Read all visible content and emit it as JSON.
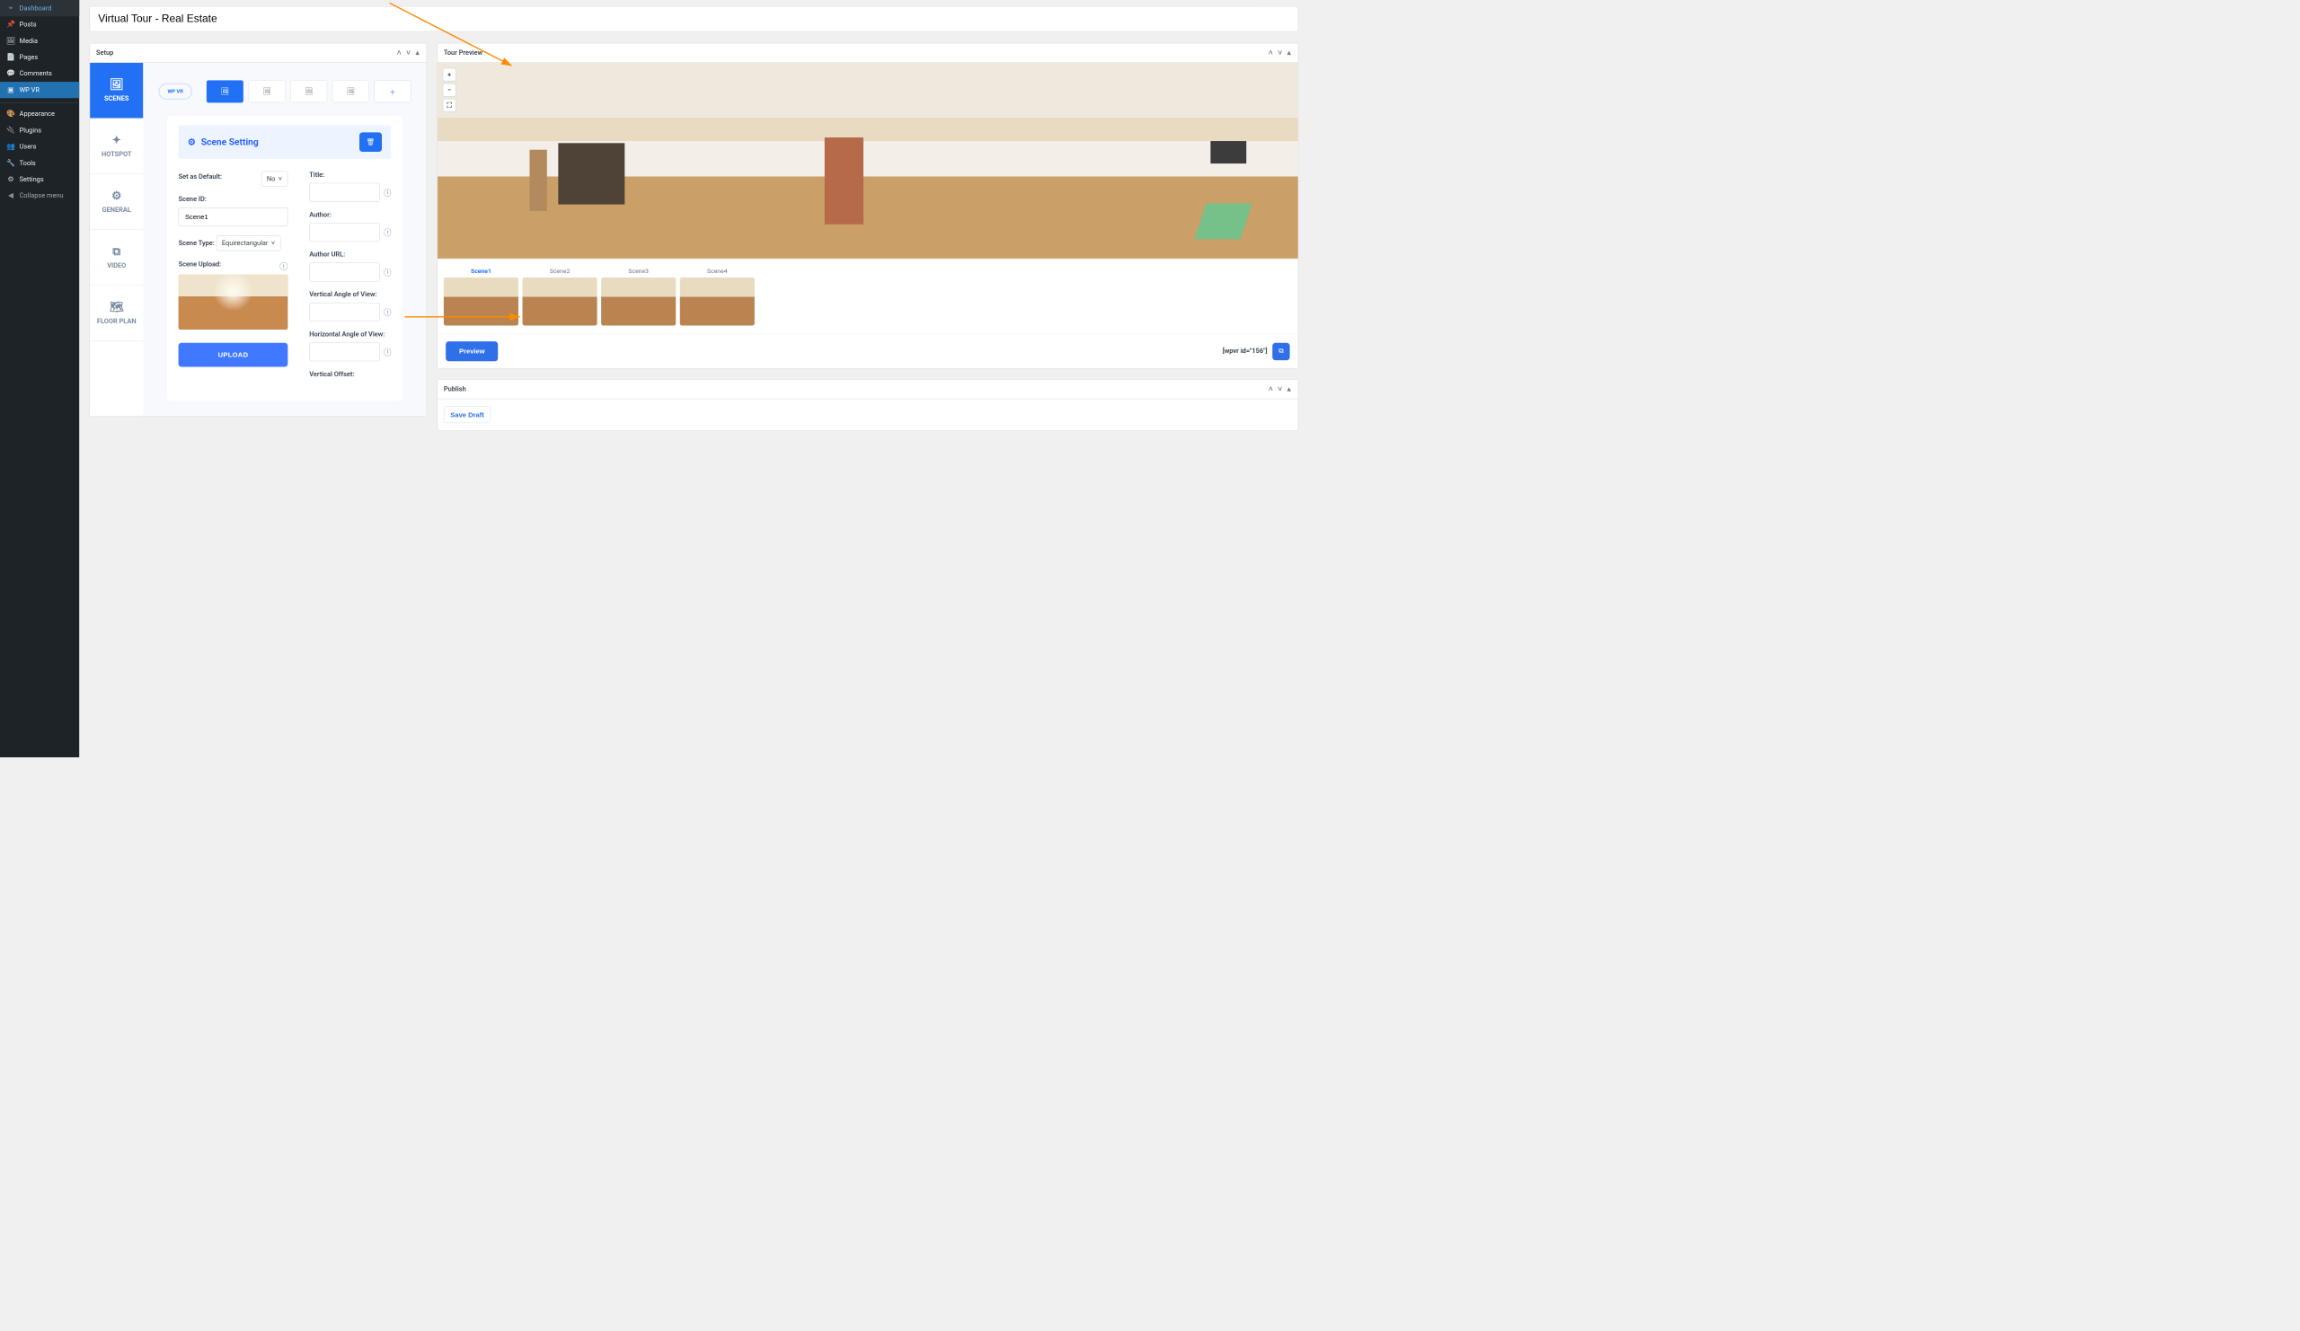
{
  "sidebar": {
    "items": [
      {
        "icon": "⌖",
        "label": "Dashboard"
      },
      {
        "icon": "📌",
        "label": "Posts"
      },
      {
        "icon": "🖼",
        "label": "Media"
      },
      {
        "icon": "📄",
        "label": "Pages"
      },
      {
        "icon": "💬",
        "label": "Comments"
      },
      {
        "icon": "▣",
        "label": "WP VR",
        "active": true
      }
    ],
    "items2": [
      {
        "icon": "🎨",
        "label": "Appearance"
      },
      {
        "icon": "🔌",
        "label": "Plugins"
      },
      {
        "icon": "👥",
        "label": "Users"
      },
      {
        "icon": "🔧",
        "label": "Tools"
      },
      {
        "icon": "⚙",
        "label": "Settings"
      }
    ],
    "collapse": "Collapse menu"
  },
  "title": "Virtual Tour - Real Estate",
  "setup": {
    "title": "Setup",
    "logo": "WP VR",
    "vtabs": [
      {
        "icon": "🖼",
        "label": "SCENES",
        "active": true
      },
      {
        "icon": "✦",
        "label": "HOTSPOT"
      },
      {
        "icon": "⚙",
        "label": "GENERAL"
      },
      {
        "icon": "⧉",
        "label": "VIDEO"
      },
      {
        "icon": "🗺",
        "label": "FLOOR PLAN"
      }
    ],
    "scene_panel": {
      "title": "Scene Setting",
      "set_default_label": "Set as Default:",
      "set_default_value": "No",
      "scene_id_label": "Scene ID:",
      "scene_id_value": "Scene1",
      "scene_type_label": "Scene Type:",
      "scene_type_value": "Equirectangular",
      "scene_upload_label": "Scene Upload:",
      "upload_btn": "UPLOAD",
      "title_label": "Title:",
      "author_label": "Author:",
      "author_url_label": "Author URL:",
      "vangle_label": "Vertical Angle of View:",
      "hangle_label": "Horizontal Angle of View:",
      "voffset_label": "Vertical Offset:"
    }
  },
  "preview": {
    "title": "Tour Preview",
    "zoom_in": "+",
    "zoom_out": "−",
    "fullscreen": "⛶",
    "scenes": [
      "Scene1",
      "Scene2",
      "Scene3",
      "Scene4"
    ],
    "preview_btn": "Preview",
    "shortcode": "[wpvr id=\"156\"]"
  },
  "publish": {
    "title": "Publish",
    "save_draft": "Save Draft"
  }
}
